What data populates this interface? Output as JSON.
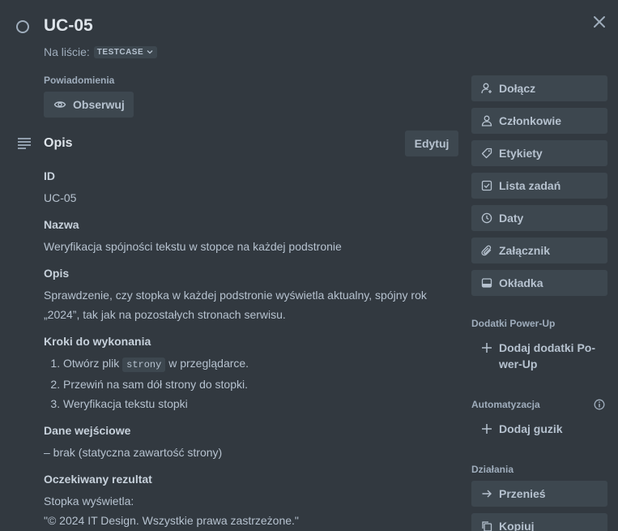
{
  "card": {
    "title": "UC-05",
    "on_list_label": "Na liście:",
    "list_name": "TESTCASE"
  },
  "notifications": {
    "label": "Powiadomienia",
    "watch_button": "Obserwuj"
  },
  "description": {
    "title": "Opis",
    "edit_button": "Edytuj",
    "id_heading": "ID",
    "id_value": "UC-05",
    "name_heading": "Nazwa",
    "name_value": "Weryfikacja spójności tekstu w stopce na każdej podstronie",
    "desc_heading": "Opis",
    "desc_line1": "Sprawdzenie, czy stopka w każdej podstronie wyświetla aktualny, spójny rok",
    "desc_line2": "„2024”, tak jak na pozostałych stronach serwisu.",
    "steps_heading": "Kroki do wykonania",
    "step1_pre": "Otwórz plik",
    "step1_code": "strony",
    "step1_post": "w przeglądarce.",
    "step2": "Przewiń na sam dół strony do stopki.",
    "step3": "Weryfikacja tekstu stopki",
    "input_heading": "Dane wejściowe",
    "input_value": "– brak (statyczna zawartość strony)",
    "expected_heading": "Oczekiwany rezultat",
    "expected_line1": "Stopka wyświetla:",
    "expected_line2": "\"© 2024 IT Design. Wszystkie prawa zastrzeżone.\""
  },
  "sidebar": {
    "join": "Dołącz",
    "members": "Członkowie",
    "labels": "Etykiety",
    "checklist": "Lista zadań",
    "dates": "Daty",
    "attachment": "Załącznik",
    "cover": "Okładka",
    "powerups_heading": "Dodatki Power-Up",
    "add_powerups_line1": "Dodaj dodatki Po-",
    "add_powerups_line2": "wer-Up",
    "automation_heading": "Automatyzacja",
    "add_button": "Dodaj guzik",
    "actions_heading": "Działania",
    "move": "Przenieś",
    "copy": "Kopiuj"
  }
}
